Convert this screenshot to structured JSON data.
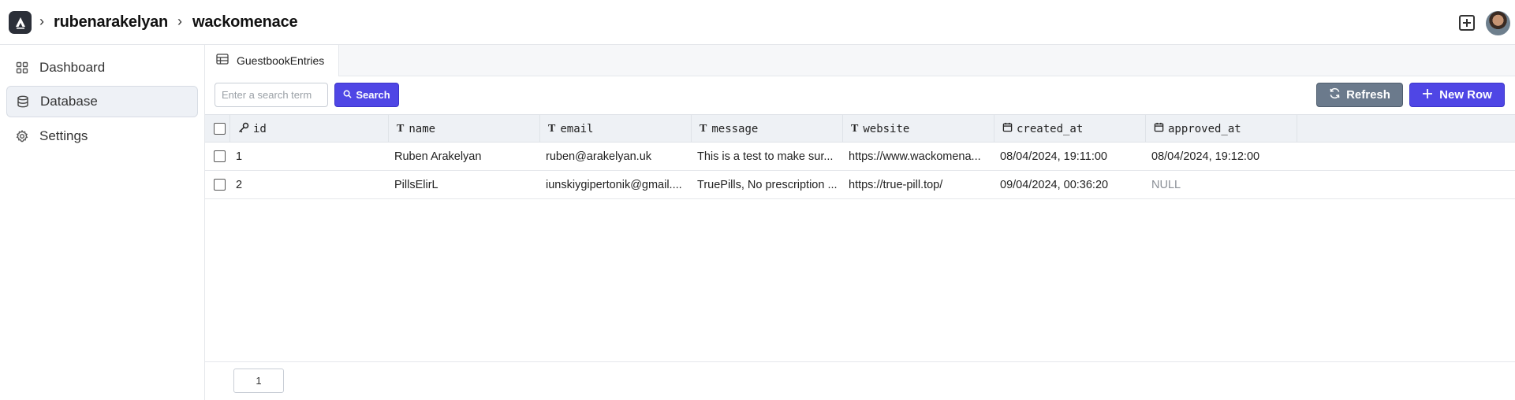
{
  "breadcrumb": {
    "user": "rubenarakelyan",
    "project": "wackomenace"
  },
  "icons": {
    "logo": "app-logo-icon",
    "separator": "chevron-right-icon",
    "new": "plus-square-icon",
    "avatar": "user-avatar"
  },
  "sidebar": {
    "items": [
      {
        "label": "Dashboard",
        "icon": "grid-icon",
        "active": false
      },
      {
        "label": "Database",
        "icon": "database-icon",
        "active": true
      },
      {
        "label": "Settings",
        "icon": "gear-icon",
        "active": false
      }
    ]
  },
  "tab": {
    "label": "GuestbookEntries",
    "icon": "table-icon"
  },
  "search": {
    "placeholder": "Enter a search term",
    "button_label": "Search"
  },
  "toolbar": {
    "refresh_label": "Refresh",
    "new_row_label": "New Row"
  },
  "table": {
    "columns": [
      {
        "name": "id",
        "icon": "key-icon"
      },
      {
        "name": "name",
        "icon": "text-type-icon"
      },
      {
        "name": "email",
        "icon": "text-type-icon"
      },
      {
        "name": "message",
        "icon": "text-type-icon"
      },
      {
        "name": "website",
        "icon": "text-type-icon"
      },
      {
        "name": "created_at",
        "icon": "calendar-icon"
      },
      {
        "name": "approved_at",
        "icon": "calendar-icon"
      }
    ],
    "rows": [
      {
        "id": "1",
        "name": "Ruben Arakelyan",
        "email": "ruben@arakelyan.uk",
        "message": "This is a test to make sur...",
        "website": "https://www.wackomena...",
        "created_at": "08/04/2024, 19:11:00",
        "approved_at": "08/04/2024, 19:12:00"
      },
      {
        "id": "2",
        "name": "PillsElirL",
        "email": "iunskiygipertonik@gmail....",
        "message": "TruePills, No prescription ...",
        "website": "https://true-pill.top/",
        "created_at": "09/04/2024, 00:36:20",
        "approved_at": "NULL"
      }
    ]
  },
  "pagination": {
    "current_page": "1"
  },
  "colors": {
    "accent": "#4f46e5",
    "refresh": "#6b7a8c",
    "null_text": "#8a8f96"
  }
}
